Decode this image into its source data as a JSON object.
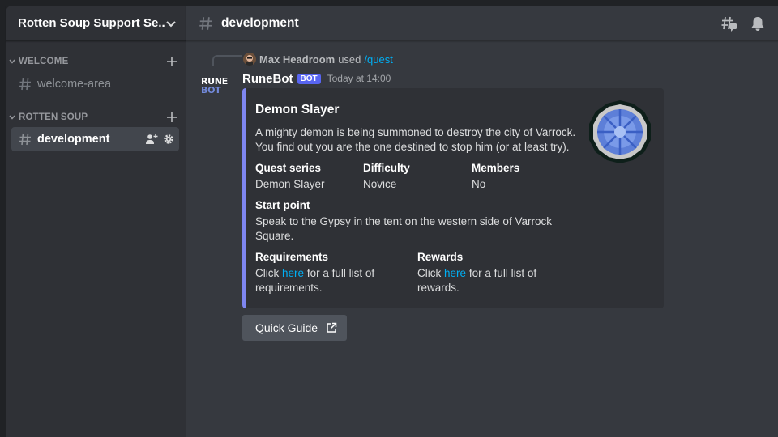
{
  "server": {
    "name": "Rotten Soup Support Se..."
  },
  "sidebar": {
    "categories": [
      {
        "label": "WELCOME",
        "channels": [
          {
            "label": "welcome-area"
          }
        ]
      },
      {
        "label": "ROTTEN SOUP",
        "channels": [
          {
            "label": "development",
            "active": true
          }
        ]
      }
    ]
  },
  "channel": {
    "title": "development"
  },
  "message": {
    "reply": {
      "user": "Max Headroom",
      "used_text": "used",
      "command": "/quest"
    },
    "avatar_line1": "RUNE",
    "avatar_line2": "BOT",
    "author": "RuneBot",
    "bot_tag": "BOT",
    "timestamp": "Today at 14:00",
    "embed": {
      "accent_color": "#7e86f0",
      "title": "Demon Slayer",
      "description": "A mighty demon is being summoned to destroy the city of Varrock. You find out you are the one destined to stop him (or at least try).",
      "fields": {
        "quest_series": {
          "name": "Quest series",
          "value": "Demon Slayer"
        },
        "difficulty": {
          "name": "Difficulty",
          "value": "Novice"
        },
        "members": {
          "name": "Members",
          "value": "No"
        },
        "start_point": {
          "name": "Start point",
          "value": "Speak to the Gypsy in the tent on the western side of Varrock Square."
        },
        "requirements": {
          "name": "Requirements",
          "prefix": "Click",
          "link": "here",
          "suffix": "for a full list of requirements."
        },
        "rewards": {
          "name": "Rewards",
          "prefix": "Click",
          "link": "here",
          "suffix": "for a full list of rewards."
        }
      },
      "thumbnail_icon": "quest-icon"
    },
    "button": {
      "label": "Quick Guide",
      "icon": "external-link-icon"
    }
  },
  "colors": {
    "blurple": "#5865f2",
    "link": "#00aff4"
  }
}
